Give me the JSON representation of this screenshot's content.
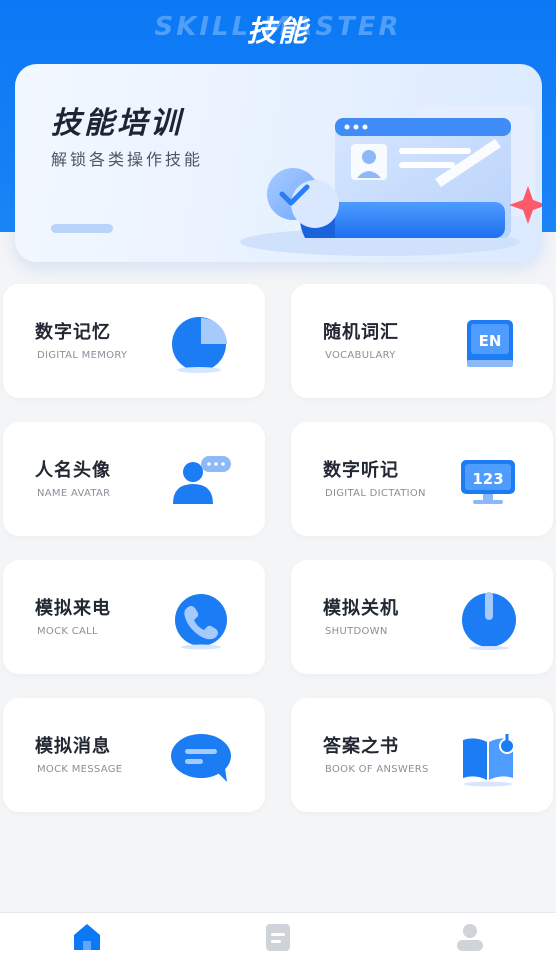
{
  "header": {
    "title": "技能",
    "watermark": "SKILL MASTER"
  },
  "banner": {
    "title": "技能培训",
    "subtitle": "解锁各类操作技能"
  },
  "cards": [
    {
      "title": "数字记忆",
      "subtitle": "DIGITAL MEMORY",
      "icon": "pie-chart-icon"
    },
    {
      "title": "随机词汇",
      "subtitle": "VOCABULARY",
      "icon": "english-book-icon"
    },
    {
      "title": "人名头像",
      "subtitle": "NAME AVATAR",
      "icon": "person-chat-icon"
    },
    {
      "title": "数字听记",
      "subtitle": "DIGITAL DICTATION",
      "icon": "monitor-123-icon"
    },
    {
      "title": "模拟来电",
      "subtitle": "MOCK CALL",
      "icon": "phone-icon"
    },
    {
      "title": "模拟关机",
      "subtitle": "SHUTDOWN",
      "icon": "power-icon"
    },
    {
      "title": "模拟消息",
      "subtitle": "MOCK MESSAGE",
      "icon": "message-bubble-icon"
    },
    {
      "title": "答案之书",
      "subtitle": "BOOK OF ANSWERS",
      "icon": "open-book-icon"
    }
  ],
  "icon_text": {
    "vocab": "EN",
    "dictation": "123"
  },
  "tabbar": {
    "items": [
      {
        "icon": "home-icon",
        "active": true
      },
      {
        "icon": "document-icon",
        "active": false
      },
      {
        "icon": "profile-icon",
        "active": false
      }
    ]
  },
  "colors": {
    "accent": "#0b78f5",
    "header_bg": "#0b78f5",
    "card_bg": "#ffffff",
    "page_bg": "#f4f5f7",
    "tab_inactive": "#cfd3da"
  }
}
